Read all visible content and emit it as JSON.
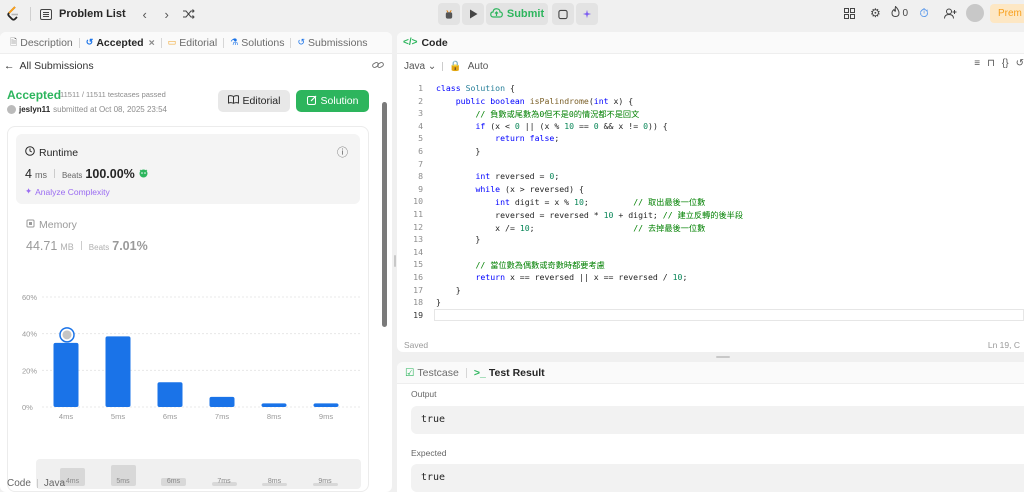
{
  "topbar": {
    "title": "Problem List",
    "submit_label": "Submit",
    "fire_count": "0",
    "premium_label": "Prem"
  },
  "left_tabs": [
    {
      "label": "Description"
    },
    {
      "label": "Accepted"
    },
    {
      "label": "Editorial"
    },
    {
      "label": "Solutions"
    },
    {
      "label": "Submissions"
    }
  ],
  "submission": {
    "back_label": "All Submissions",
    "status": "Accepted",
    "testcases": "11511 / 11511 testcases passed",
    "user": "jeslyn11",
    "submitted": "submitted at Oct 08, 2025 23:54",
    "editorial_btn": "Editorial",
    "solution_btn": "Solution"
  },
  "runtime": {
    "title": "Runtime",
    "value": "4",
    "unit": "ms",
    "beats_label": "Beats",
    "beats": "100.00%",
    "analyze": "Analyze Complexity"
  },
  "memory": {
    "title": "Memory",
    "value": "44.71",
    "unit": "MB",
    "beats_label": "Beats",
    "beats": "7.01%"
  },
  "chart_data": {
    "type": "bar",
    "categories": [
      "4ms",
      "5ms",
      "6ms",
      "7ms",
      "8ms",
      "9ms"
    ],
    "values": [
      35,
      38.5,
      13.5,
      5.5,
      2,
      2
    ],
    "yticks": [
      "0%",
      "20%",
      "40%",
      "60%"
    ],
    "ylim": [
      0,
      60
    ],
    "highlight": "4ms",
    "bar_color": "#1a73e8",
    "grid": true
  },
  "minimap_labels": [
    "4ms",
    "5ms",
    "6ms",
    "7ms",
    "8ms",
    "9ms"
  ],
  "left_bottom": {
    "label": "Code",
    "lang": "Java"
  },
  "code": {
    "title": "Code",
    "language": "Java",
    "mode": "Auto",
    "saved": "Saved",
    "position": "Ln 19, C",
    "lines": [
      "class Solution {",
      "    public boolean isPalindrome(int x) {",
      "        // 負數或尾數為0但不是0的情況都不是回文",
      "        if (x < 0 || (x % 10 == 0 && x != 0)) {",
      "            return false;",
      "        }",
      "",
      "        int reversed = 0;",
      "        while (x > reversed) {",
      "            int digit = x % 10;         // 取出最後一位數",
      "            reversed = reversed * 10 + digit; // 建立反轉的後半段",
      "            x /= 10;                    // 去掉最後一位數",
      "        }",
      "",
      "        // 當位數為偶數或奇數時都要考慮",
      "        return x == reversed || x == reversed / 10;",
      "    }",
      "}",
      ""
    ]
  },
  "test": {
    "testcase_tab": "Testcase",
    "result_tab": "Test Result",
    "output_label": "Output",
    "output_value": "true",
    "expected_label": "Expected",
    "expected_value": "true"
  }
}
